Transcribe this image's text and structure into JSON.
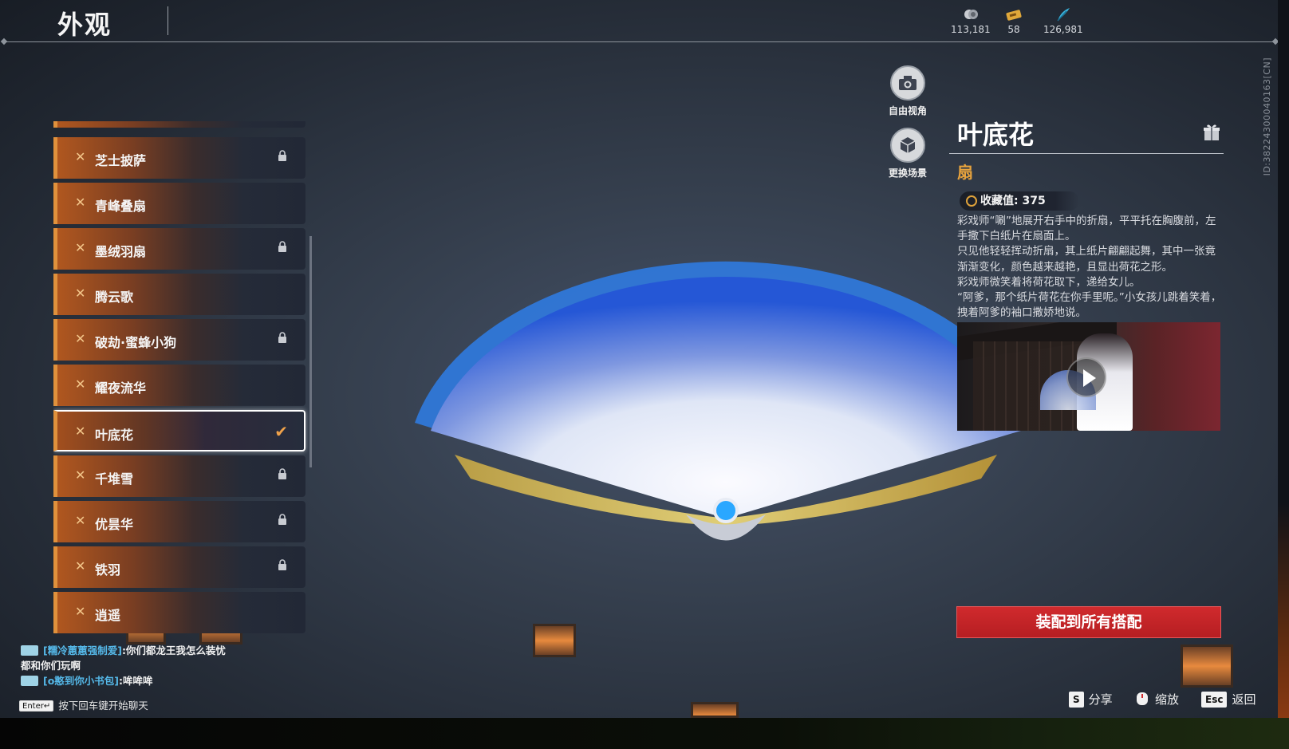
{
  "header": {
    "title": "外观",
    "currencies": [
      {
        "icon": "silver-coin-icon",
        "value": "113,181"
      },
      {
        "icon": "ticket-icon",
        "value": "58"
      },
      {
        "icon": "feather-icon",
        "value": "126,981"
      }
    ]
  },
  "list": {
    "items": [
      {
        "label": "芝士披萨",
        "locked": true
      },
      {
        "label": "青峰叠扇",
        "locked": false
      },
      {
        "label": "墨绒羽扇",
        "locked": true
      },
      {
        "label": "腾云歌",
        "locked": false
      },
      {
        "label": "破劫·蜜蜂小狗",
        "locked": true
      },
      {
        "label": "耀夜流华",
        "locked": false
      },
      {
        "label": "叶底花",
        "locked": false,
        "selected": true
      },
      {
        "label": "千堆雪",
        "locked": true
      },
      {
        "label": "优昙华",
        "locked": true
      },
      {
        "label": "铁羽",
        "locked": true
      },
      {
        "label": "逍遥",
        "locked": false
      }
    ]
  },
  "side_buttons": {
    "free_view": "自由视角",
    "change_scene": "更换场景"
  },
  "detail": {
    "name": "叶底花",
    "category": "扇",
    "collect_label": "收藏值:",
    "collect_value": "375",
    "description": [
      "彩戏师“唰”地展开右手中的折扇，平平托在胸腹前，左手撒下白纸片在扇面上。",
      "只见他轻轻挥动折扇，其上纸片翩翩起舞，其中一张竟渐渐变化，颜色越来越艳，且显出荷花之形。",
      "彩戏师微笑着将荷花取下，递给女儿。",
      "“阿爹，那个纸片荷花在你手里呢。”小女孩儿跳着笑着，拽着阿爹的袖口撒娇地说。"
    ],
    "equip_all_label": "装配到所有搭配",
    "id_text": "ID:38224300040163[CN]"
  },
  "chat": {
    "lines": [
      {
        "name": "[糯冷蕙蕙强制爱]",
        "text": ":你们都龙王我怎么装忧"
      },
      {
        "name": "",
        "text": "都和你们玩啊"
      },
      {
        "name": "[o憨到你小书包]",
        "text": ":哞哞哞"
      }
    ],
    "hint_key": "Enter↵",
    "hint_text": "按下回车键开始聊天"
  },
  "hotkeys": [
    {
      "key": "S",
      "label": "分享"
    },
    {
      "key": "",
      "label": "缩放"
    },
    {
      "key": "Esc",
      "label": "返回"
    }
  ],
  "colors": {
    "accent_orange": "#e0913c",
    "equip_red": "#c92427",
    "category_gold": "#e7a33d"
  }
}
